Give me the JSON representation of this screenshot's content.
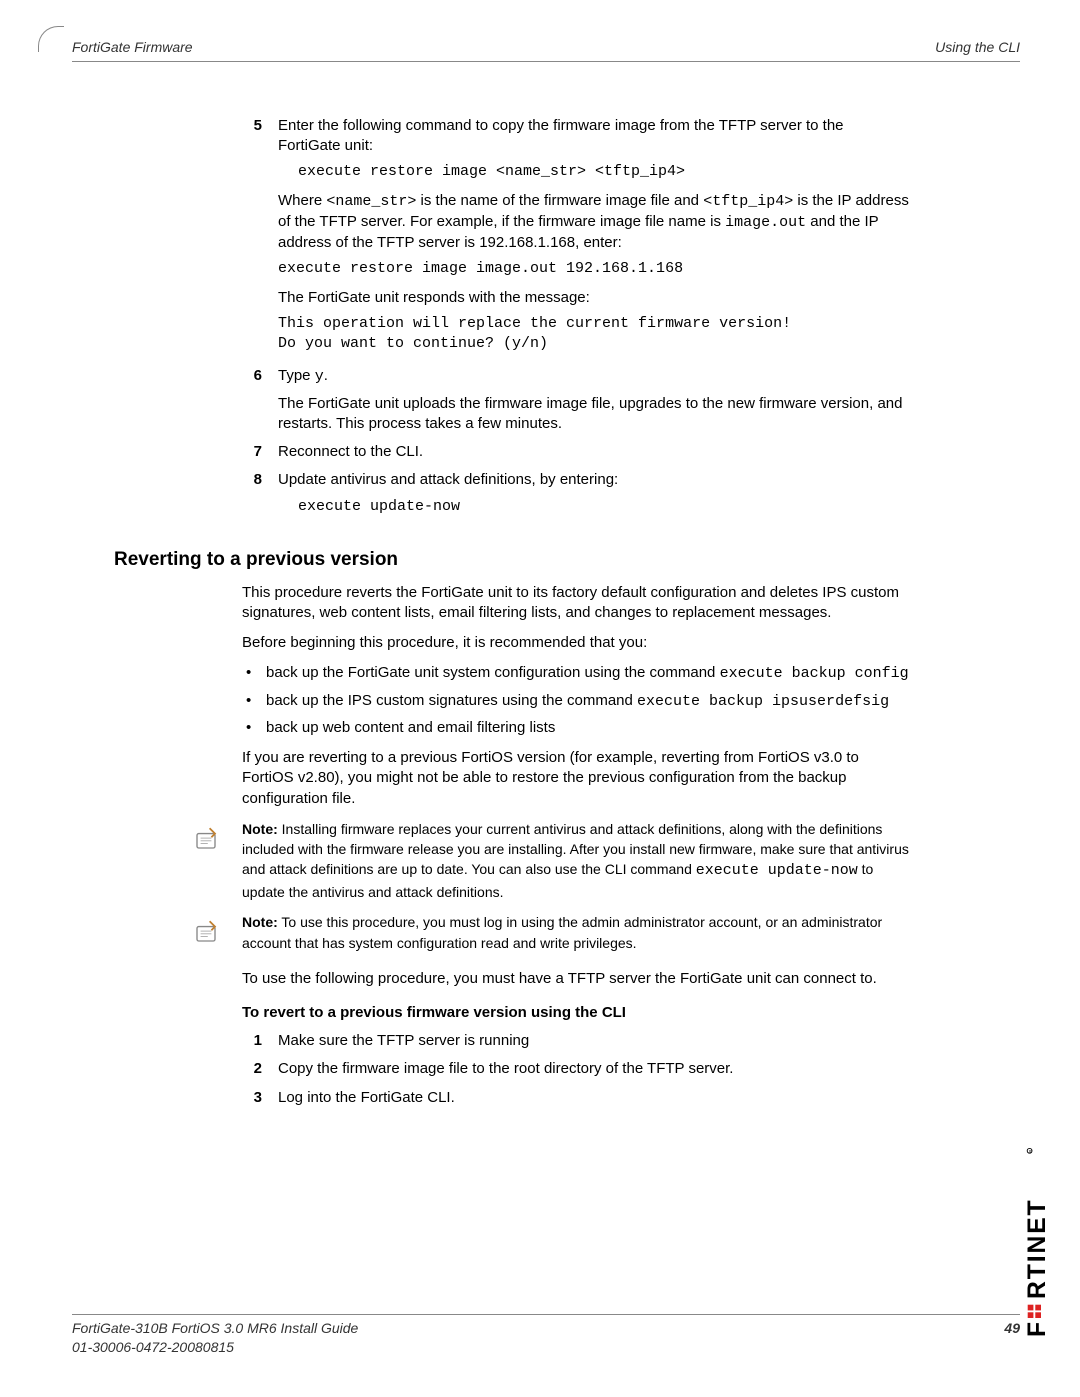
{
  "header": {
    "left": "FortiGate Firmware",
    "right": "Using the CLI"
  },
  "step5": {
    "num": "5",
    "intro": "Enter the following command to copy the firmware image from the TFTP server to the FortiGate unit:",
    "cmd1": "execute restore image <name_str> <tftp_ip4>",
    "where_a": "Where ",
    "where_name": "<name_str>",
    "where_b": " is the name of the firmware image file and ",
    "where_tftp": "<tftp_ip4>",
    "where_c": " is the IP address of the TFTP server. For example, if the firmware image file name is ",
    "where_img": "image.out",
    "where_d": " and the IP address of the TFTP server is 192.168.1.168, enter:",
    "cmd2": "execute restore image image.out 192.168.1.168",
    "responds": "The FortiGate unit responds with the message:",
    "cmd3": "This operation will replace the current firmware version!\nDo you want to continue? (y/n)"
  },
  "step6": {
    "num": "6",
    "a": "Type ",
    "y": "y",
    "b": ".",
    "desc": "The FortiGate unit uploads the firmware image file, upgrades to the new firmware version, and restarts. This process takes a few minutes."
  },
  "step7": {
    "num": "7",
    "text": "Reconnect to the CLI."
  },
  "step8": {
    "num": "8",
    "text": "Update antivirus and attack definitions, by entering:",
    "cmd": "execute update-now"
  },
  "section": {
    "title": "Reverting to a previous version",
    "p1": "This procedure reverts the FortiGate unit to its factory default configuration and deletes IPS custom signatures, web content lists, email filtering lists, and changes to replacement messages.",
    "p2": "Before beginning this procedure, it is recommended that you:",
    "b1a": "back up the FortiGate unit system configuration using the command ",
    "b1b": "execute backup config",
    "b2a": "back up the IPS custom signatures using the command ",
    "b2b": "execute backup ipsuserdefsig",
    "b3": "back up web content and email filtering lists",
    "p3": "If you are reverting to a previous FortiOS version (for example, reverting from FortiOS v3.0 to FortiOS v2.80), you might not be able to restore the previous configuration from the backup configuration file.",
    "note1_label": "Note:",
    "note1_a": " Installing firmware replaces your current antivirus and attack definitions, along with the definitions included with the firmware release you are installing. After you install new firmware, make sure that antivirus and attack definitions are up to date. You can also use the CLI command ",
    "note1_cmd": "execute update-now",
    "note1_b": " to update the antivirus and attack definitions.",
    "note2_label": "Note:",
    "note2": " To use this procedure, you must log in using the admin administrator account, or an administrator account that has system configuration read and write privileges.",
    "p4": "To use the following procedure, you must have a TFTP server the FortiGate unit can connect to.",
    "subhead": "To revert to a previous firmware version using the CLI",
    "s1": {
      "num": "1",
      "text": "Make sure the TFTP server is running"
    },
    "s2": {
      "num": "2",
      "text": "Copy the firmware image file to the root directory of the TFTP server."
    },
    "s3": {
      "num": "3",
      "text": "Log into the FortiGate CLI."
    }
  },
  "footer": {
    "line1": "FortiGate-310B FortiOS 3.0 MR6 Install Guide",
    "line2": "01-30006-0472-20080815",
    "page": "49"
  }
}
